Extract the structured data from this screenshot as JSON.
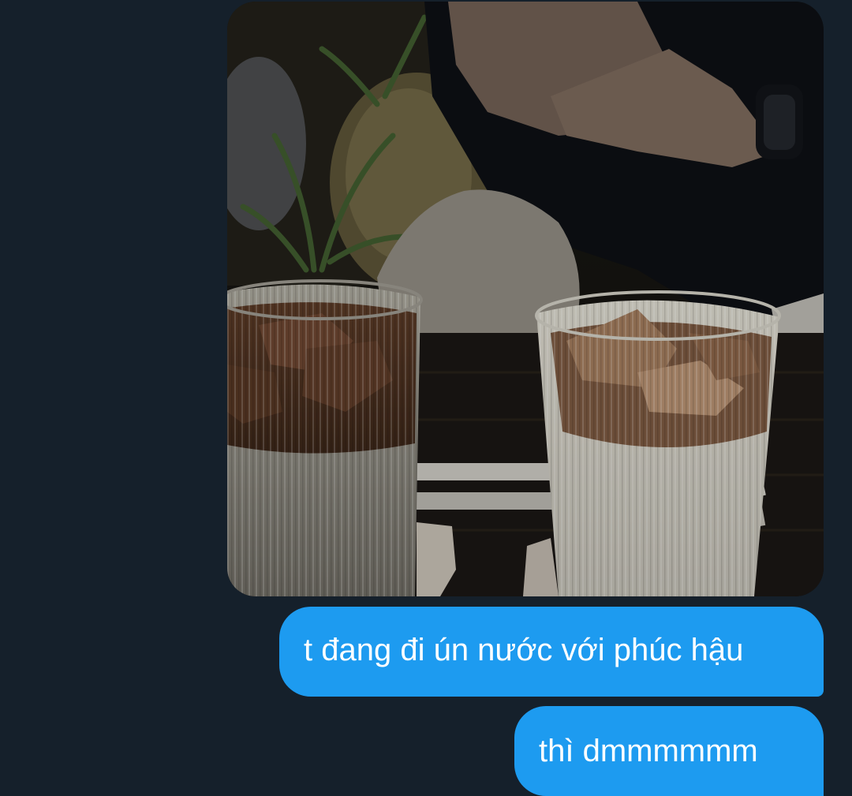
{
  "conversation": {
    "attachment": {
      "kind": "photo",
      "subject": "two-ribbed-glasses-of-iced-coffee-drink"
    },
    "messages": [
      {
        "text": "t đang đi ún nước với phúc hậu",
        "direction": "outgoing"
      },
      {
        "text": "thì dmmmmmm",
        "direction": "outgoing"
      }
    ]
  },
  "colors": {
    "background": "#15202b",
    "bubble": "#1d9bf0",
    "bubble_text": "#ffffff"
  }
}
